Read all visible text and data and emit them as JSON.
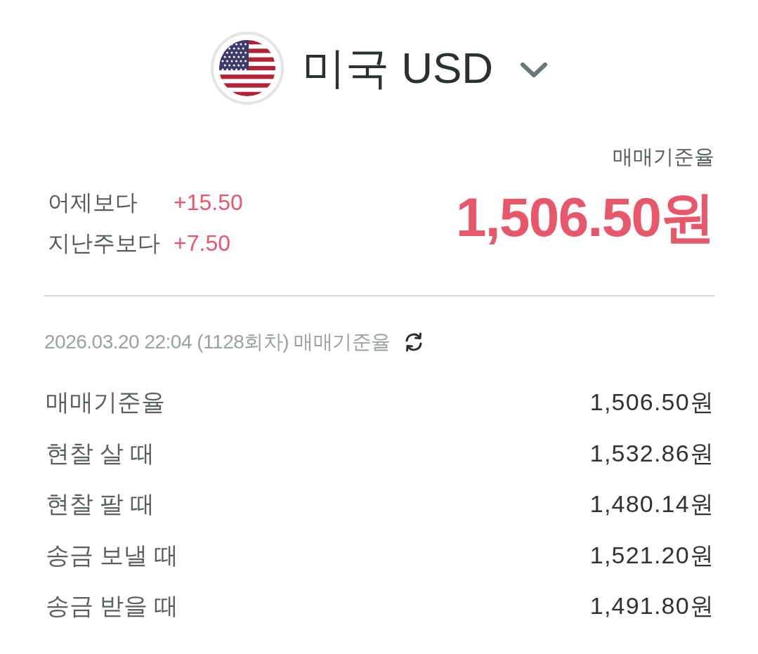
{
  "header": {
    "title": "미국 USD"
  },
  "summary": {
    "changes": [
      {
        "label": "어제보다",
        "value": "+15.50",
        "rising": true
      },
      {
        "label": "지난주보다",
        "value": "+7.50",
        "rising": true
      }
    ],
    "rate_label": "매매기준율",
    "rate": "1,506.50원",
    "rising": true
  },
  "timestamp": "2026.03.20 22:04 (1128회차) 매매기준율",
  "rates": [
    {
      "label": "매매기준율",
      "value": "1,506.50원"
    },
    {
      "label": "현찰 살 때",
      "value": "1,532.86원"
    },
    {
      "label": "현찰 팔 때",
      "value": "1,480.14원"
    },
    {
      "label": "송금 보낼 때",
      "value": "1,521.20원"
    },
    {
      "label": "송금 받을 때",
      "value": "1,491.80원"
    }
  ]
}
